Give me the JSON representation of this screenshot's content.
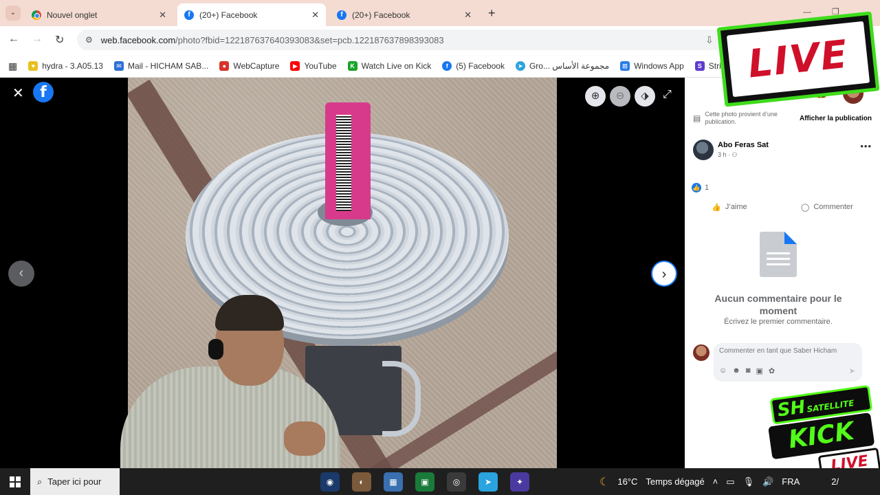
{
  "browser": {
    "tabs": [
      {
        "title": "Nouvel onglet",
        "icon": "chrome-icon",
        "active": false
      },
      {
        "title": "(20+) Facebook",
        "icon": "facebook-icon",
        "active": true
      },
      {
        "title": "(20+) Facebook",
        "icon": "facebook-icon",
        "active": false
      }
    ],
    "url_host": "web.facebook.com",
    "url_path": "/photo?fbid=122187637640393083&set=pcb.122187637898393083",
    "bookmarks": [
      {
        "label": "hydra - 3.A05.13",
        "icon": "hydra-icon",
        "color": "#e8c020"
      },
      {
        "label": "Mail - HICHAM SAB...",
        "icon": "mail-icon",
        "color": "#2c6fd6"
      },
      {
        "label": "WebCapture",
        "icon": "webcapture-icon",
        "color": "#d8322a"
      },
      {
        "label": "YouTube",
        "icon": "youtube-icon",
        "color": "#ff0000"
      },
      {
        "label": "Watch Live on Kick",
        "icon": "kick-icon",
        "color": "#1aa32a"
      },
      {
        "label": "(5) Facebook",
        "icon": "facebook-icon",
        "color": "#1877f2"
      },
      {
        "label": "Gro... مجموعة الأساس",
        "icon": "telegram-icon",
        "color": "#2aa3de"
      },
      {
        "label": "Windows App",
        "icon": "windows-icon",
        "color": "#2b7de9"
      },
      {
        "label": "Stripe Express",
        "icon": "stripe-icon",
        "color": "#5e3bd1"
      }
    ]
  },
  "viewer": {
    "tools": [
      "zoom-in-icon",
      "zoom-out-icon",
      "tag-icon"
    ]
  },
  "panel": {
    "source_note": "Cette photo provient d’une publication.",
    "source_link": "Afficher la publication",
    "author": "Abo Feras Sat",
    "time": "3 h ·",
    "reactions_count": "1",
    "like_label": "J’aime",
    "comment_label": "Commenter",
    "empty_title": "Aucun commentaire pour le moment",
    "empty_sub": "Écrivez le premier commentaire.",
    "composer_placeholder": "Commenter en tant que Saber Hicham"
  },
  "overlays": {
    "live_text": "LIVE",
    "kick_sh": "SH",
    "kick_satellite": "SATELLITE",
    "kick_word": "KICK",
    "kick_live": "LIVE"
  },
  "taskbar": {
    "search_placeholder": "Taper ici pour",
    "weather": "16°C",
    "weather_desc": "Temps dégagé",
    "lang": "FRA",
    "clock": "2/"
  }
}
